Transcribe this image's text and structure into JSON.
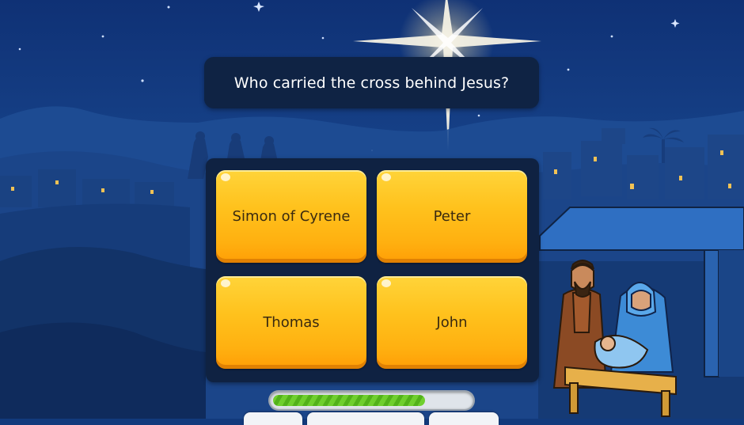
{
  "question": {
    "text": "Who carried the cross behind Jesus?"
  },
  "answers": [
    {
      "label": "Simon of Cyrene"
    },
    {
      "label": "Peter"
    },
    {
      "label": "Thomas"
    },
    {
      "label": "John"
    }
  ],
  "progress": {
    "fraction": 0.77
  },
  "colors": {
    "sky": "#163f86",
    "panel": "#0f2344",
    "answer_button": "#ffbe1a",
    "progress_fill": "#5fc023"
  }
}
